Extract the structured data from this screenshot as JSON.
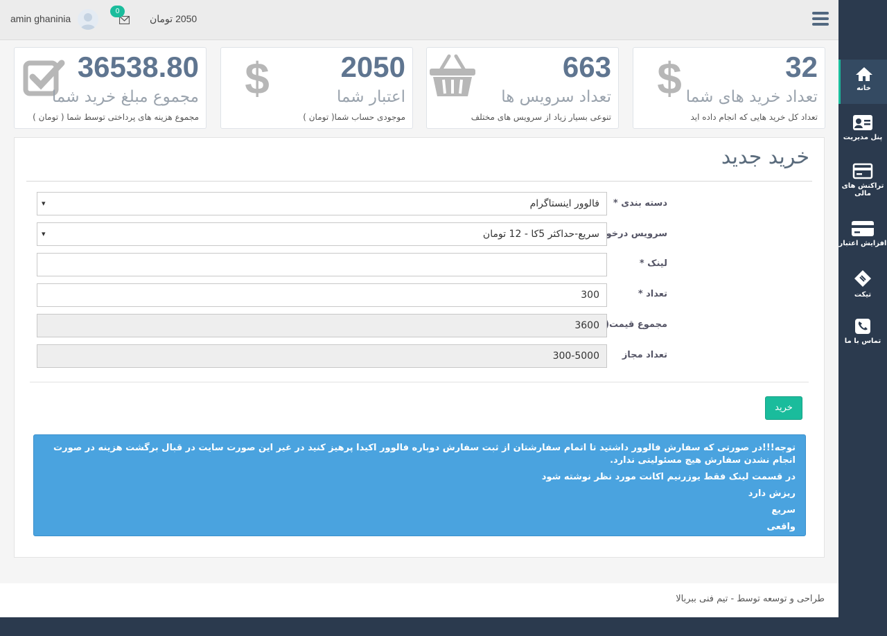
{
  "header": {
    "username": "amin ghaninia",
    "notification_count": "0",
    "balance": "2050 تومان"
  },
  "stats": [
    {
      "value": "36538.80",
      "title": "مجموع مبلغ خرید شما",
      "desc": "مجموع هزینه های پرداختی توسط شما ( تومان )",
      "icon": "check-square-icon"
    },
    {
      "value": "2050",
      "title": "اعتبار شما",
      "desc": "موجودی حساب شما( تومان )",
      "icon": "dollar-icon"
    },
    {
      "value": "663",
      "title": "تعداد سرویس ها",
      "desc": "تنوعی بسیار زیاد از سرویس های مختلف",
      "icon": "basket-icon"
    },
    {
      "value": "32",
      "title": "تعداد خرید های شما",
      "desc": "تعداد کل خرید هایی که انجام داده اید",
      "icon": "dollar-icon"
    }
  ],
  "form": {
    "title": "خرید جدید",
    "category_label": "دسته بندی *",
    "category_value": "فالوور اینستاگرام",
    "service_label": "سرویس درخواستی *",
    "service_value": "سریع-حداکثر 5کا - 12 تومان",
    "link_label": "لینک *",
    "link_value": "",
    "quantity_label": "تعداد *",
    "quantity_value": "300",
    "total_label": "مجموع قیمت( تومان )",
    "total_value": "3600",
    "allowed_label": "تعداد مجاز",
    "allowed_value": "300-5000",
    "submit_label": "خرید"
  },
  "notice": {
    "lines": [
      "توجه!!!در صورتی که سفارش فالوور داشتید تا اتمام سفارشتان از ثبت سفارش دوباره فالوور اکیدا پرهیز کنید در غیر این صورت سایت در قبال برگشت هزینه در صورت انجام نشدن سفارش هیچ مسئولیتی ندارد.",
      "در قسمت لینک فقط یوزرنیم اکانت مورد نظر نوشته شود",
      "ریزش دارد",
      "سریع",
      "واقعی"
    ]
  },
  "footer": {
    "text": "طراحی و توسعه توسط - تیم فنی ببربالا"
  },
  "sidebar": {
    "items": [
      {
        "label": "خانه",
        "icon": "home-icon",
        "active": true
      },
      {
        "label": "پنل مدیریت",
        "icon": "id-card-icon"
      },
      {
        "label": "تراکنش های مالی",
        "icon": "credit-card-icon"
      },
      {
        "label": "افزایش اعتبار",
        "icon": "card-icon"
      },
      {
        "label": "تیکت",
        "icon": "ticket-icon"
      },
      {
        "label": "تماس با ما",
        "icon": "phone-icon"
      }
    ]
  },
  "colors": {
    "accent": "#1abc9c",
    "sidebar": "#2b3a4e",
    "alert": "#4aa3df"
  }
}
